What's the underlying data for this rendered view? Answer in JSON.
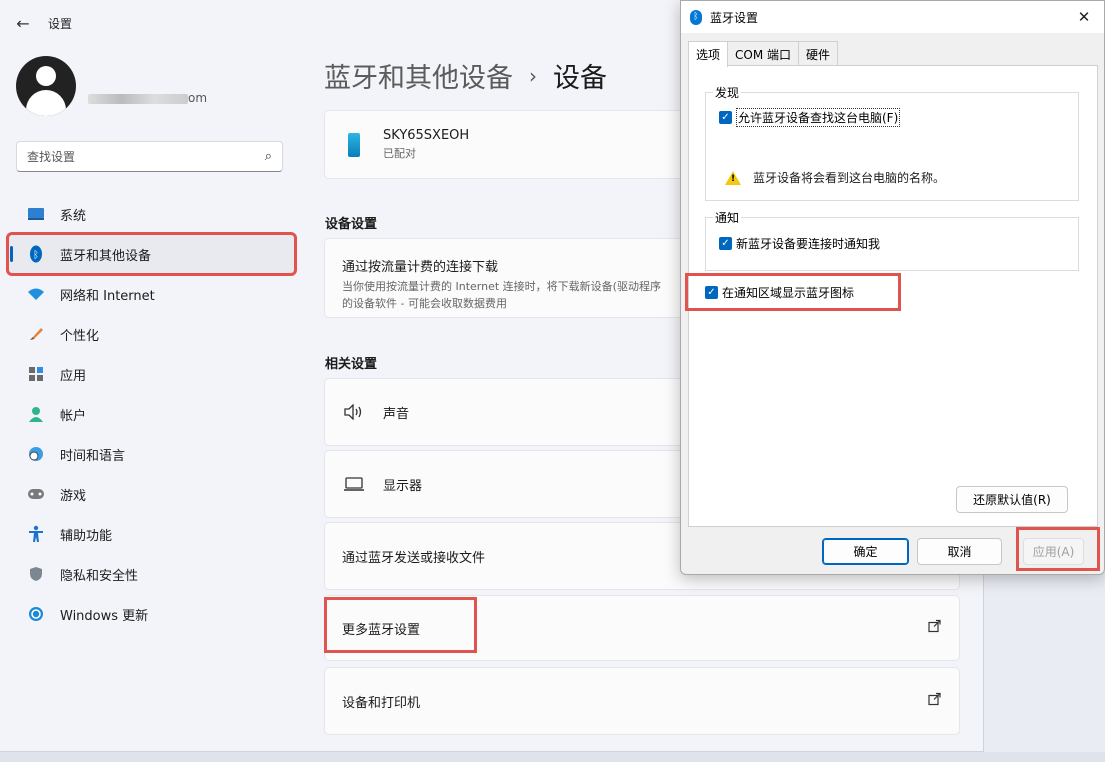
{
  "app": {
    "title": "设置"
  },
  "profile": {
    "email_suffix": "om"
  },
  "search": {
    "placeholder": "查找设置"
  },
  "sidebar": {
    "items": [
      {
        "label": "系统"
      },
      {
        "label": "蓝牙和其他设备"
      },
      {
        "label": "网络和 Internet"
      },
      {
        "label": "个性化"
      },
      {
        "label": "应用"
      },
      {
        "label": "帐户"
      },
      {
        "label": "时间和语言"
      },
      {
        "label": "游戏"
      },
      {
        "label": "辅助功能"
      },
      {
        "label": "隐私和安全性"
      },
      {
        "label": "Windows 更新"
      }
    ]
  },
  "breadcrumb": {
    "parent": "蓝牙和其他设备",
    "separator": "›",
    "current": "设备"
  },
  "device": {
    "name": "SKY65SXEOH",
    "status": "已配对"
  },
  "device_settings": {
    "heading": "设备设置",
    "metered_title": "通过按流量计费的连接下载",
    "metered_desc_1": "当你使用按流量计费的 Internet 连接时，将下载新设备(驱动程序",
    "metered_desc_2": "的设备软件 - 可能会收取数据费用"
  },
  "related": {
    "heading": "相关设置",
    "sound": "声音",
    "display": "显示器",
    "send_receive": "通过蓝牙发送或接收文件",
    "more_bt": "更多蓝牙设置",
    "devices_printers": "设备和打印机"
  },
  "dialog": {
    "title": "蓝牙设置",
    "tabs": [
      "选项",
      "COM 端口",
      "硬件"
    ],
    "discovery": {
      "title": "发现",
      "allow_label": "允许蓝牙设备查找这台电脑(F)",
      "warning": "蓝牙设备将会看到这台电脑的名称。"
    },
    "notify": {
      "title": "通知",
      "new_device_label": "新蓝牙设备要连接时通知我"
    },
    "show_icon_label": "在通知区域显示蓝牙图标",
    "restore_defaults": "还原默认值(R)",
    "ok": "确定",
    "cancel": "取消",
    "apply": "应用(A)"
  },
  "colors": {
    "accent": "#0067c0",
    "highlight": "#e0534f",
    "warning": "#f2c811"
  }
}
